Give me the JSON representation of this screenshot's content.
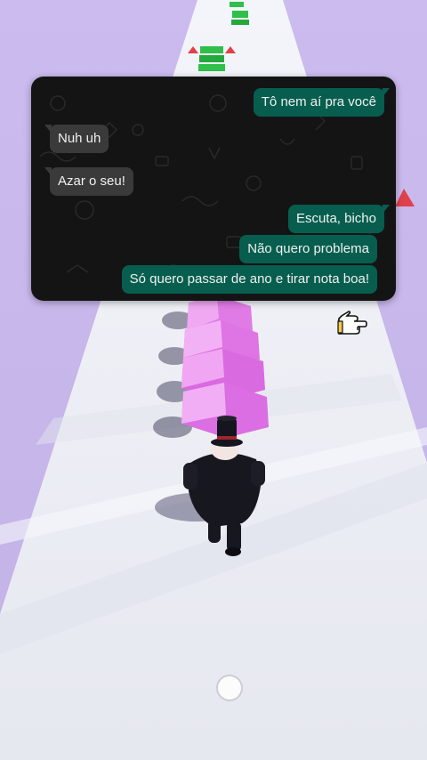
{
  "chat": {
    "messages": [
      {
        "side": "out",
        "text": "Tô nem aí pra você"
      },
      {
        "side": "in",
        "text": "Nuh uh"
      },
      {
        "side": "in",
        "text": "Azar o seu!"
      },
      {
        "side": "out",
        "text": "Escuta, bicho"
      },
      {
        "side": "out",
        "text": "Não quero problema"
      },
      {
        "side": "out",
        "text": "Só quero passar de ano e tirar nota boa!"
      }
    ]
  },
  "game": {
    "character": "top-hat-suit-runner",
    "stack_color": "#e07be6",
    "track_color": "#eef0f6",
    "background_color": "#c9b8ea",
    "money_color": "#2fbf4a",
    "spike_color": "#e0404a"
  },
  "icons": {
    "pointer": "pointing-hand-icon",
    "home": "home-button-icon"
  }
}
